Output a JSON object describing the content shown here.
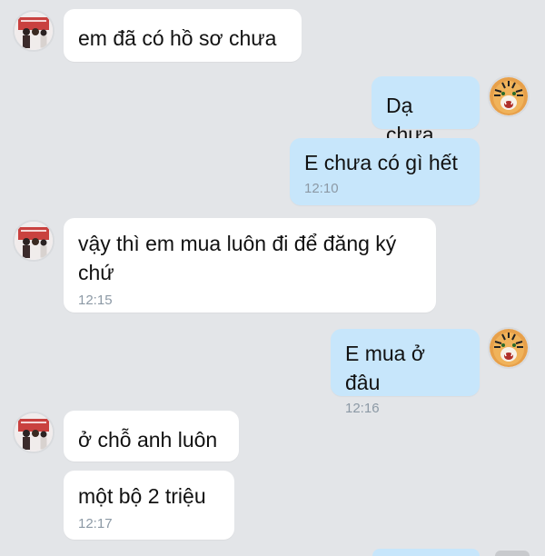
{
  "messages": [
    {
      "side": "in",
      "text": "em đã có hồ sơ chưa",
      "time": ""
    },
    {
      "side": "out",
      "text": "Dạ chưa",
      "time": ""
    },
    {
      "side": "out",
      "text": "E chưa có gì hết",
      "time": "12:10"
    },
    {
      "side": "in",
      "text": "vậy thì em mua luôn đi để đăng ký chứ",
      "time": "12:15"
    },
    {
      "side": "out",
      "text": "E mua ở đâu",
      "time": "12:16"
    },
    {
      "side": "in",
      "text": "ở chỗ anh luôn",
      "time": ""
    },
    {
      "side": "in",
      "text": "một bộ 2 triệu",
      "time": "12:17"
    }
  ],
  "avatars": {
    "contact": "group-photo-avatar",
    "self": "tiger-avatar"
  },
  "colors": {
    "background": "#e3e5e8",
    "incoming_bubble": "#ffffff",
    "outgoing_bubble": "#c7e6fb",
    "timestamp": "#8c99a5"
  }
}
